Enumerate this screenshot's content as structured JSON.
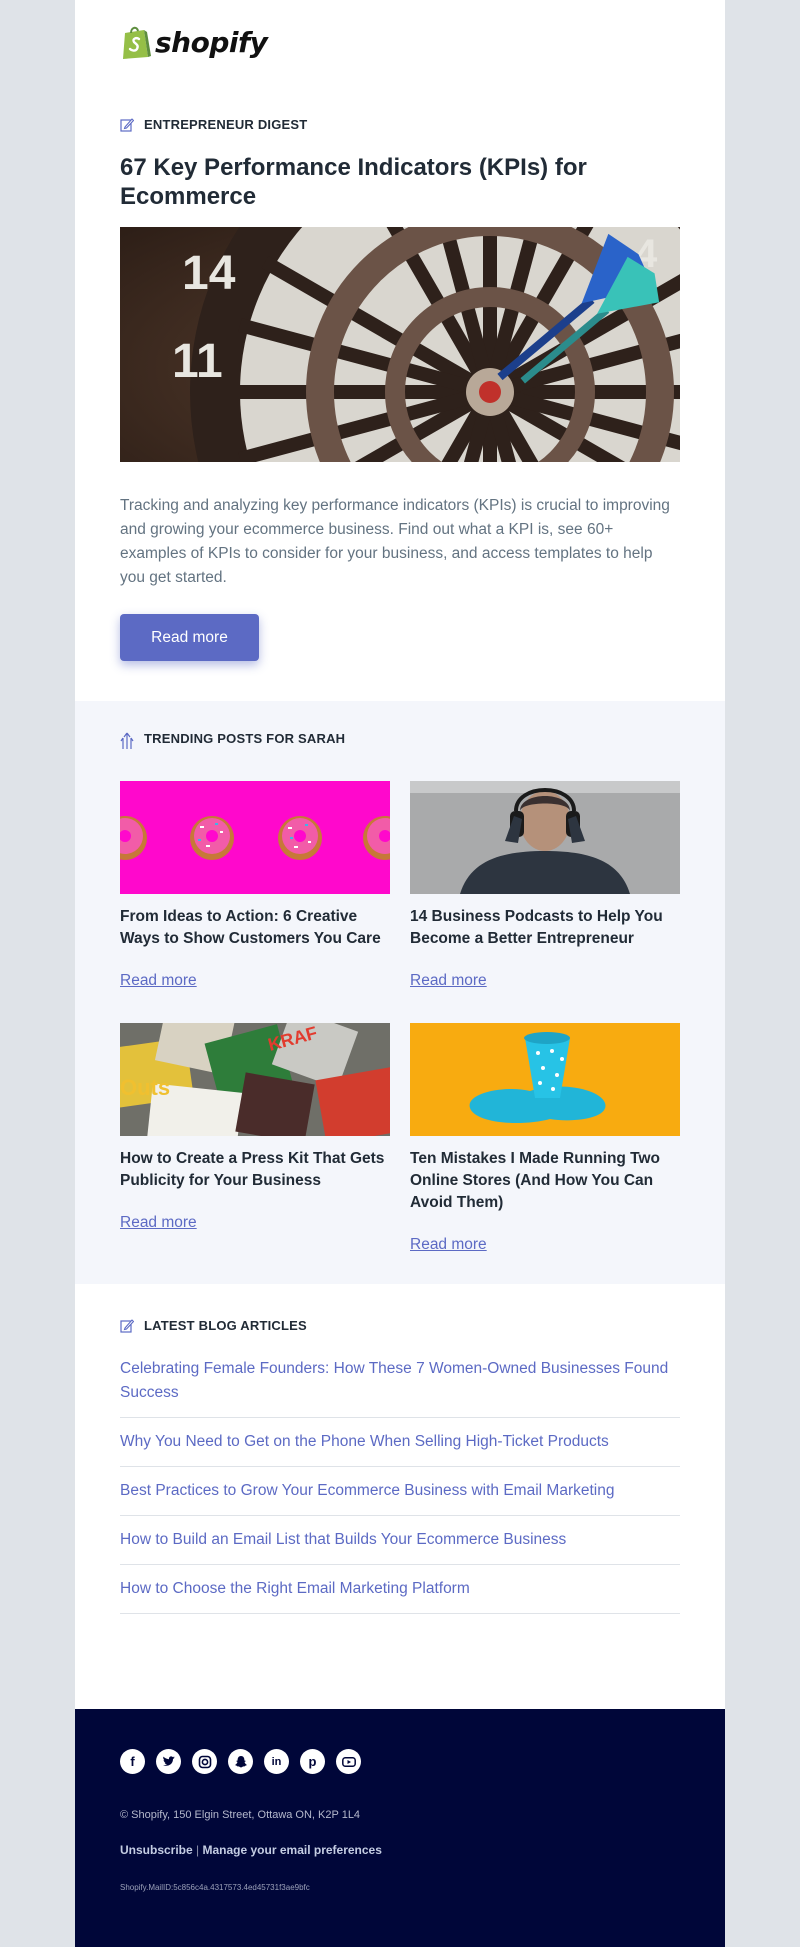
{
  "brand": {
    "name": "shopify",
    "color": "#95bf47"
  },
  "feature": {
    "label": "ENTREPRENEUR DIGEST",
    "title": "67 Key Performance Indicators (KPIs) for Ecommerce",
    "image_icon": "dartboard-image",
    "description": "Tracking and analyzing key performance indicators (KPIs) is crucial to improving and growing your ecommerce business. Find out what a KPI is, see 60+ examples of KPIs to consider for your business, and access templates to help you get started.",
    "button": "Read more"
  },
  "trending": {
    "label": "TRENDING POSTS FOR SARAH",
    "cards": [
      {
        "title": "From Ideas to Action: 6 Creative Ways to Show Customers You Care",
        "link": "Read more",
        "image": "donuts-image"
      },
      {
        "title": "14 Business Podcasts to Help You Become a Better Entrepreneur",
        "link": "Read more",
        "image": "headphones-image"
      },
      {
        "title": "How to Create a Press Kit That Gets Publicity for Your Business",
        "link": "Read more",
        "image": "magazines-image"
      },
      {
        "title": "Ten Mistakes I Made Running Two Online Stores (And How You Can Avoid Them)",
        "link": "Read more",
        "image": "melting-cup-image"
      }
    ]
  },
  "latest": {
    "label": "LATEST BLOG ARTICLES",
    "articles": [
      "Celebrating Female Founders: How These 7 Women-Owned Businesses Found Success",
      "Why You Need to Get on the Phone When Selling High-Ticket Products",
      "Best Practices to Grow Your Ecommerce Business with Email Marketing",
      "How to Build an Email List that Builds Your Ecommerce Business",
      "How to Choose the Right Email Marketing Platform"
    ]
  },
  "footer": {
    "socials": [
      "facebook-icon",
      "twitter-icon",
      "instagram-icon",
      "snapchat-icon",
      "linkedin-icon",
      "pinterest-icon",
      "youtube-icon"
    ],
    "address": "© Shopify,  150 Elgin Street, Ottawa ON, K2P 1L4",
    "unsubscribe": "Unsubscribe",
    "separator": "|",
    "preferences": "Manage your email preferences",
    "mail_id": "Shopify.MailID:5c856c4a.4317573.4ed45731f3ae9bfc"
  },
  "colors": {
    "accent": "#5c6ac4",
    "footer_bg": "#000639",
    "trending_bg": "#f4f6fb",
    "page_bg": "#dfe3e8"
  }
}
